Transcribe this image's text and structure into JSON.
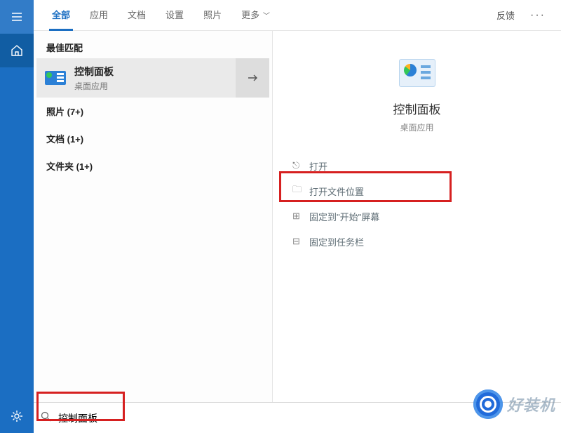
{
  "rail": {
    "menu_icon": "menu-icon",
    "home_icon": "home-icon",
    "settings_icon": "gear-icon"
  },
  "tabs": {
    "all": "全部",
    "apps": "应用",
    "docs": "文档",
    "settings": "设置",
    "photos": "照片",
    "more": "更多",
    "feedback": "反馈"
  },
  "results": {
    "best_match_label": "最佳匹配",
    "best_match": {
      "title": "控制面板",
      "subtitle": "桌面应用"
    },
    "categories": [
      "照片 (7+)",
      "文档 (1+)",
      "文件夹 (1+)"
    ]
  },
  "detail": {
    "title": "控制面板",
    "subtitle": "桌面应用",
    "actions": {
      "open": "打开",
      "open_location": "打开文件位置",
      "pin_start": "固定到\"开始\"屏幕",
      "pin_taskbar": "固定到任务栏"
    }
  },
  "search": {
    "value": "控制面板"
  },
  "watermark": "好装机"
}
